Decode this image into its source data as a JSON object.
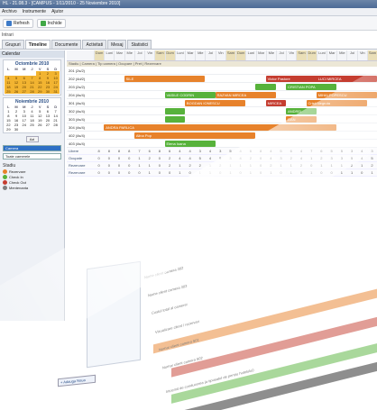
{
  "window": {
    "title": "HL - 21.08.3 - [CAMPUS - 1/11/2010 - 25 Noviembre 2010]"
  },
  "menu": {
    "items": [
      "Archivo",
      "Instrumente",
      "Ajutor"
    ]
  },
  "toolbar": {
    "refresh": "Refresh",
    "close": "Inchide"
  },
  "breadcrumb": "Intrari",
  "tabs": [
    "Grupuri",
    "Timeline",
    "Documente",
    "Activitati",
    "Mesaj",
    "Statistici"
  ],
  "active_tab": 1,
  "left": {
    "header": "Calendar",
    "cal1": {
      "title": "Octombrie 2010",
      "days": [
        "L",
        "M",
        "M",
        "J",
        "V",
        "S",
        "D"
      ],
      "dates": [
        "",
        "",
        "",
        "",
        "1",
        "2",
        "3",
        "4",
        "5",
        "6",
        "7",
        "8",
        "9",
        "10",
        "11",
        "12",
        "13",
        "14",
        "15",
        "16",
        "17",
        "18",
        "19",
        "20",
        "21",
        "22",
        "23",
        "24",
        "25",
        "26",
        "27",
        "28",
        "29",
        "30",
        "31"
      ],
      "highlight": [
        4,
        5,
        6,
        7,
        8,
        9,
        10,
        11,
        12,
        13,
        14,
        15,
        16,
        17,
        18,
        19,
        20,
        21,
        22,
        23,
        24,
        25,
        26,
        27,
        28,
        29,
        30,
        31,
        32,
        33,
        34
      ]
    },
    "cal2": {
      "title": "Noiembrie 2010",
      "days": [
        "L",
        "M",
        "M",
        "J",
        "V",
        "S",
        "D"
      ],
      "dates": [
        "1",
        "2",
        "3",
        "4",
        "5",
        "6",
        "7",
        "8",
        "9",
        "10",
        "11",
        "12",
        "13",
        "14",
        "15",
        "16",
        "17",
        "18",
        "19",
        "20",
        "21",
        "22",
        "23",
        "24",
        "25",
        "26",
        "27",
        "28",
        "29",
        "30"
      ],
      "highlight": []
    },
    "today_btn": "Azi",
    "select1": "Camera",
    "select2": "Toate camerele",
    "legend_title": "Stadiu",
    "legend": [
      {
        "label": "Rezervare",
        "color": "#e7822b"
      },
      {
        "label": "Check In",
        "color": "#57b23b"
      },
      {
        "label": "Check Out",
        "color": "#c53d30"
      },
      {
        "label": "Mentenanta",
        "color": "#7f7f7f"
      }
    ]
  },
  "timeline": {
    "days": [
      "Dum",
      "Luni",
      "Mar",
      "Mie",
      "Joi",
      "Vin",
      "Sam",
      "Dum",
      "Luni",
      "Mar",
      "Mie",
      "Joi",
      "Vin",
      "Sam",
      "Dum",
      "Luni",
      "Mar",
      "Mie",
      "Joi",
      "Vin",
      "Sam",
      "Dum",
      "Luni",
      "Mar",
      "Mie",
      "Joi",
      "Vin",
      "Sam"
    ],
    "subheader": "Stadiu  |  Camera  |  Tip camera  |  Ocupare  |  Pret  |  Rezervare",
    "rooms": [
      {
        "label": "201 (2s/2)",
        "bars": []
      },
      {
        "label": "202 (4d/2)",
        "bars": [
          {
            "text": "SILE",
            "c": "o"
          },
          {
            "text": "Victor Pastore",
            "c": "r"
          },
          {
            "text": "LUCI MIRCEA",
            "c": "r"
          }
        ]
      },
      {
        "label": "203 (2s/2)",
        "bars": [
          {
            "text": "",
            "c": "g"
          },
          {
            "text": "CRISTIAN POPA",
            "c": "g"
          }
        ]
      },
      {
        "label": "204 (4s/4)",
        "bars": [
          {
            "text": "VASILE CODRIN",
            "c": "g"
          },
          {
            "text": "RAZVAN MIRCEA",
            "c": "o"
          },
          {
            "text": "MIHAI POPESCU",
            "c": "o"
          }
        ]
      },
      {
        "label": "301 (4s/4)",
        "bars": [
          {
            "text": "BOGDAN IONESCU",
            "c": "o"
          },
          {
            "text": "MIRCEA",
            "c": "r"
          },
          {
            "text": "Cristi Negruta",
            "c": "o"
          }
        ]
      },
      {
        "label": "302 (4s/4)",
        "bars": [
          {
            "text": "",
            "c": "g"
          },
          {
            "text": "ANDREI",
            "c": "g"
          }
        ]
      },
      {
        "label": "303 (4s/4)",
        "bars": [
          {
            "text": "",
            "c": "g"
          },
          {
            "text": "DAN",
            "c": "o"
          }
        ]
      },
      {
        "label": "304 (4s/4)",
        "bars": [
          {
            "text": "ANDRA PARLICA",
            "c": "o"
          }
        ]
      },
      {
        "label": "402 (4s/4)",
        "bars": [
          {
            "text": "Alina Pop",
            "c": "o"
          }
        ]
      },
      {
        "label": "403 (4s/4)",
        "bars": [
          {
            "text": "Elena Ioana",
            "c": "g"
          }
        ]
      }
    ],
    "stats": [
      {
        "label": "Libere",
        "values": [
          8,
          8,
          8,
          8,
          7,
          6,
          8,
          6,
          4,
          4,
          3,
          4,
          3,
          5,
          4,
          6,
          8,
          4,
          5,
          6,
          4,
          7,
          6,
          5,
          5,
          3,
          4,
          3
        ]
      },
      {
        "label": "Ocupate",
        "values": [
          0,
          0,
          0,
          0,
          1,
          2,
          0,
          2,
          4,
          4,
          5,
          4,
          5,
          3,
          4,
          2,
          0,
          4,
          3,
          2,
          4,
          1,
          2,
          3,
          3,
          5,
          4,
          5
        ]
      },
      {
        "label": "Rezervare",
        "values": [
          0,
          0,
          0,
          0,
          1,
          1,
          0,
          2,
          1,
          2,
          2,
          1,
          2,
          1,
          1,
          1,
          0,
          2,
          1,
          1,
          2,
          0,
          1,
          1,
          1,
          2,
          1,
          2
        ]
      },
      {
        "label": "Rezervare",
        "values": [
          0,
          0,
          0,
          0,
          0,
          1,
          0,
          0,
          1,
          0,
          1,
          1,
          0,
          1,
          0,
          1,
          0,
          1,
          0,
          1,
          0,
          1,
          0,
          0,
          1,
          1,
          0,
          1
        ]
      }
    ]
  },
  "ghost": {
    "bottom_button": "+ Adauga Noua",
    "items": [
      "Nume client camera 302",
      "Nume client camera 303",
      "Costul total al camerei",
      "Vizualizare client / rezervari",
      "Numar client camera 501",
      "Numar client camera 502",
      "Intocmit de conducerea (a tiposatul de pentru hotelului)"
    ]
  }
}
